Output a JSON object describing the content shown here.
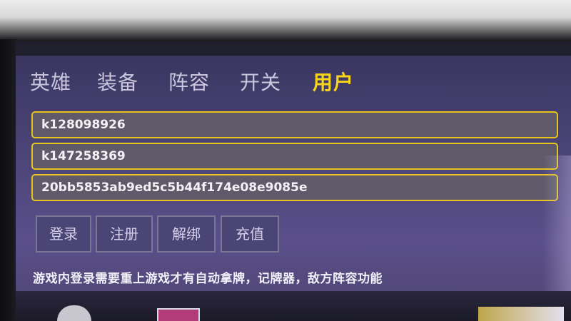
{
  "tabs": [
    {
      "label": "英雄",
      "active": false
    },
    {
      "label": "装备",
      "active": false
    },
    {
      "label": "阵容",
      "active": false
    },
    {
      "label": "开关",
      "active": false
    },
    {
      "label": "用户",
      "active": true
    }
  ],
  "fields": {
    "username": "k128098926",
    "password": "k147258369",
    "key": "20bb5853ab9ed5c5b44f174e08e9085e"
  },
  "buttons": {
    "login": "登录",
    "register": "注册",
    "unbind": "解绑",
    "recharge": "充值"
  },
  "note": "游戏内登录需要重上游戏才有自动拿牌，记牌器，敌方阵容功能",
  "colors": {
    "accent": "#f7d51a",
    "field_bg": "#5e5a6a",
    "panel_bg": "#4a4476"
  }
}
